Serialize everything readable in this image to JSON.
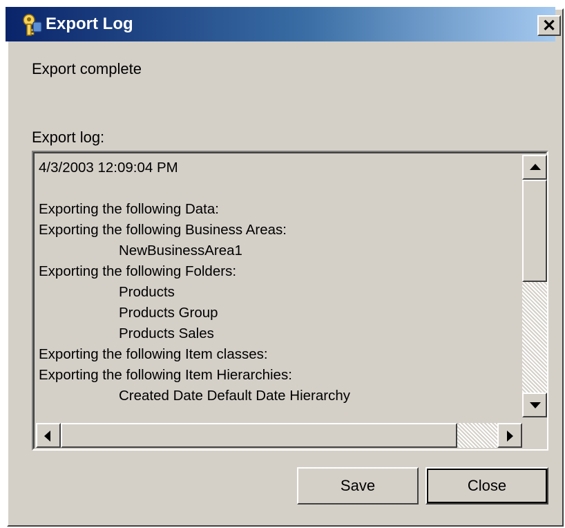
{
  "window": {
    "title": "Export Log",
    "close_glyph": "✕"
  },
  "dialog": {
    "status_text": "Export complete",
    "log_label": "Export log:",
    "log_lines": [
      {
        "text": "4/3/2003 12:09:04 PM",
        "indent": false
      },
      {
        "text": "",
        "indent": false
      },
      {
        "text": "Exporting the following Data:",
        "indent": false
      },
      {
        "text": "Exporting the following Business Areas:",
        "indent": false
      },
      {
        "text": "NewBusinessArea1",
        "indent": true
      },
      {
        "text": "Exporting the following Folders:",
        "indent": false
      },
      {
        "text": "Products",
        "indent": true
      },
      {
        "text": "Products Group",
        "indent": true
      },
      {
        "text": "Products Sales",
        "indent": true
      },
      {
        "text": "Exporting the following Item classes:",
        "indent": false
      },
      {
        "text": "Exporting the following Item Hierarchies:",
        "indent": false
      },
      {
        "text": "Created Date Default Date Hierarchy",
        "indent": true
      }
    ]
  },
  "buttons": {
    "save_label": "Save",
    "close_label": "Close"
  },
  "icons": {
    "app": "export-key-icon",
    "close": "close-icon",
    "scroll_up": "scroll-up-arrow-icon",
    "scroll_down": "scroll-down-arrow-icon",
    "scroll_left": "scroll-left-arrow-icon",
    "scroll_right": "scroll-right-arrow-icon"
  },
  "colors": {
    "titlebar_start": "#0a246a",
    "titlebar_end": "#a6caf0",
    "dialog_face": "#d4d0c8"
  }
}
